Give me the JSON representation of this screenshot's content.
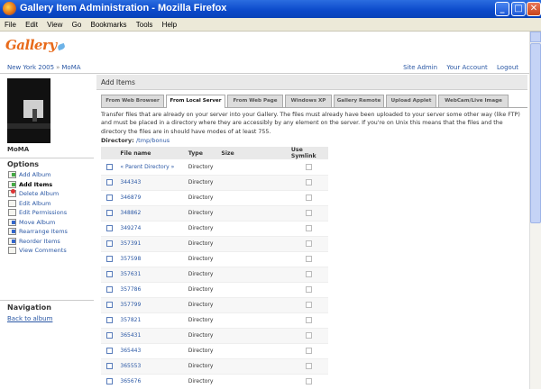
{
  "window": {
    "title": "Gallery Item Administration - Mozilla Firefox",
    "controls": {
      "minimize": "_",
      "maximize": "□",
      "close": "✕"
    }
  },
  "menubar": {
    "items": [
      "File",
      "Edit",
      "View",
      "Go",
      "Bookmarks",
      "Tools",
      "Help"
    ]
  },
  "logo": {
    "text": "Gallery"
  },
  "breadcrumb": {
    "items": [
      "New York 2005",
      "MoMA"
    ],
    "separator": "»"
  },
  "toplinks": [
    "Site Admin",
    "Your Account",
    "Logout"
  ],
  "sidebar": {
    "thumbnail_caption": "MoMA",
    "options_heading": "Options",
    "options": [
      {
        "label": "Add Album",
        "icon": "add-album-icon",
        "active": false
      },
      {
        "label": "Add Items",
        "icon": "add-items-icon",
        "active": true
      },
      {
        "label": "Delete Album",
        "icon": "delete-icon",
        "active": false
      },
      {
        "label": "Edit Album",
        "icon": "edit-icon",
        "active": false
      },
      {
        "label": "Edit Permissions",
        "icon": "permissions-icon",
        "active": false
      },
      {
        "label": "Move Album",
        "icon": "move-icon",
        "active": false
      },
      {
        "label": "Rearrange Items",
        "icon": "rearrange-icon",
        "active": false
      },
      {
        "label": "Reorder Items",
        "icon": "reorder-icon",
        "active": false
      },
      {
        "label": "View Comments",
        "icon": "comments-icon",
        "active": false
      }
    ],
    "navigation_heading": "Navigation",
    "back_link": "Back to album"
  },
  "main": {
    "heading": "Add Items",
    "tabs": [
      {
        "label": "From Web Browser",
        "active": false
      },
      {
        "label": "From Local Server",
        "active": true
      },
      {
        "label": "From Web Page",
        "active": false
      },
      {
        "label": "Windows XP",
        "active": false
      },
      {
        "label": "Gallery Remote",
        "active": false
      },
      {
        "label": "Upload Applet",
        "active": false
      },
      {
        "label": "WebCam/Live Image",
        "active": false
      }
    ],
    "intro": "Transfer files that are already on your server into your Gallery. The files must already have been uploaded to your server some other way (like FTP) and must be placed in a directory where they are accessibly by any element on the server. If you're on Unix this means that the files and the directory the files are in should have modes of at least 755.",
    "directory_label": "Directory:",
    "directory_path": "/tmp/bonus",
    "columns": [
      "File name",
      "Type",
      "Size",
      "Use Symlink"
    ],
    "rows": [
      {
        "name": "« Parent Directory »",
        "type": "Directory"
      },
      {
        "name": "344343",
        "type": "Directory"
      },
      {
        "name": "346879",
        "type": "Directory"
      },
      {
        "name": "348862",
        "type": "Directory"
      },
      {
        "name": "349274",
        "type": "Directory"
      },
      {
        "name": "357391",
        "type": "Directory"
      },
      {
        "name": "357598",
        "type": "Directory"
      },
      {
        "name": "357631",
        "type": "Directory"
      },
      {
        "name": "357786",
        "type": "Directory"
      },
      {
        "name": "357799",
        "type": "Directory"
      },
      {
        "name": "357821",
        "type": "Directory"
      },
      {
        "name": "365431",
        "type": "Directory"
      },
      {
        "name": "365443",
        "type": "Directory"
      },
      {
        "name": "365553",
        "type": "Directory"
      },
      {
        "name": "365676",
        "type": "Directory"
      }
    ]
  }
}
